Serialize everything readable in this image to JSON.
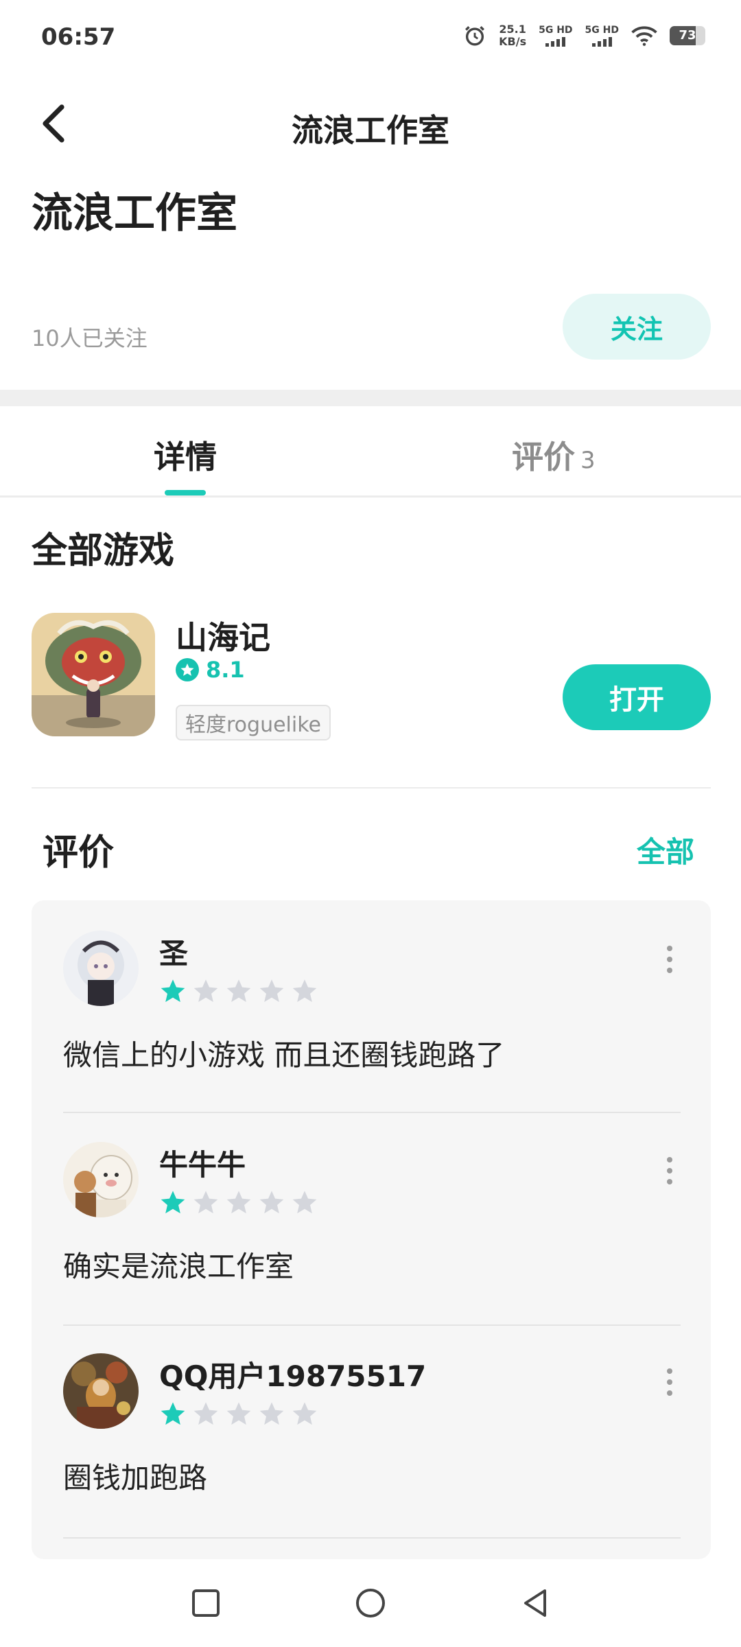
{
  "status_bar": {
    "time": "06:57",
    "net_speed_value": "25.1",
    "net_speed_unit": "KB/s",
    "sim1_label": "5G HD",
    "sim2_label": "5G HD",
    "battery": "73",
    "battery_level": 0.73,
    "icons": [
      "alarm-icon",
      "signal-icon",
      "signal-icon",
      "wifi-icon",
      "battery-icon"
    ]
  },
  "header": {
    "title": "流浪工作室",
    "back_icon": "back-arrow-icon"
  },
  "studio": {
    "name": "流浪工作室",
    "followers": "10人已关注",
    "follow_label": "关注"
  },
  "tabs": [
    {
      "label": "详情",
      "active": true
    },
    {
      "label": "评价",
      "count": "3",
      "active": false
    }
  ],
  "games_section": {
    "title": "全部游戏",
    "games": [
      {
        "name": "山海记",
        "rating": "8.1",
        "tag": "轻度roguelike",
        "open_label": "打开"
      }
    ]
  },
  "reviews_section": {
    "title": "评价",
    "all_label": "全部",
    "reviews": [
      {
        "user": "圣",
        "stars": 1,
        "max_stars": 5,
        "text": "微信上的小游戏 而且还圈钱跑路了"
      },
      {
        "user": "牛牛牛",
        "stars": 1,
        "max_stars": 5,
        "text": "确实是流浪工作室"
      },
      {
        "user": "QQ用户19875517",
        "stars": 1,
        "max_stars": 5,
        "text": "圈钱加跑路"
      }
    ]
  },
  "colors": {
    "accent": "#1ccbb8",
    "accent_light": "#e4f7f5",
    "star_empty": "#d4d6dc"
  },
  "nav_bar": {
    "icons": [
      "recent-apps-icon",
      "home-icon",
      "back-icon"
    ]
  }
}
